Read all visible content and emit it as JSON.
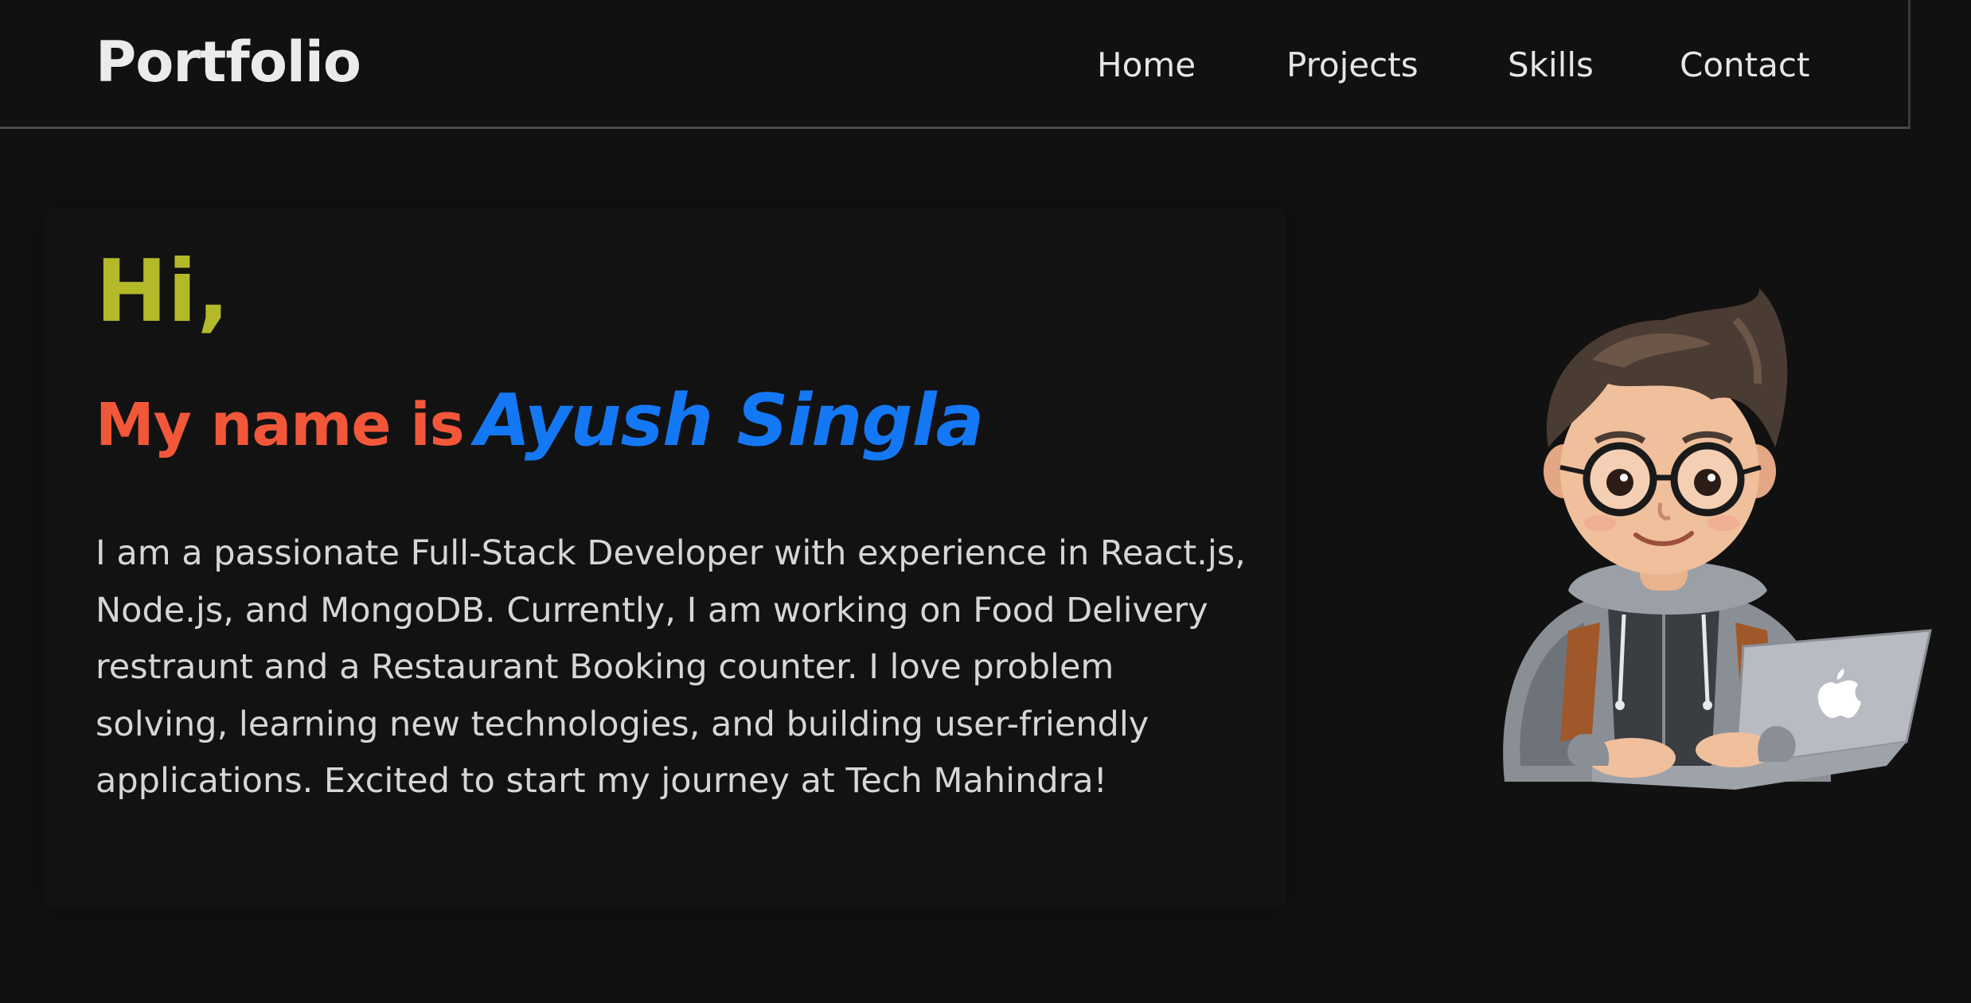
{
  "brand": "Portfolio",
  "nav": {
    "home": "Home",
    "projects": "Projects",
    "skills": "Skills",
    "contact": "Contact"
  },
  "hero": {
    "greeting": "Hi,",
    "name_prefix": "My name is",
    "name": "Ayush  Singla",
    "bio": "I am a passionate Full-Stack Developer with experience in React.js, Node.js, and MongoDB. Currently, I am working on Food Delivery restraunt and a Restaurant Booking counter. I love problem solving, learning new technologies, and building user-friendly applications. Excited to start my journey at Tech Mahindra!"
  },
  "colors": {
    "background": "#111111",
    "greeting": "#b4b92a",
    "name_prefix": "#f2573a",
    "name": "#1478f5",
    "text": "#d6d6d6"
  },
  "icons": {
    "avatar": "developer-avatar-illustration",
    "laptop_logo": "apple-logo-icon"
  }
}
